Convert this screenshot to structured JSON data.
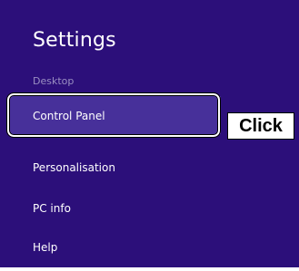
{
  "settings_pane": {
    "title": "Settings",
    "subtitle": "Desktop",
    "items": [
      {
        "label": "Control Panel"
      },
      {
        "label": "Personalisation"
      },
      {
        "label": "PC info"
      },
      {
        "label": "Help"
      }
    ]
  },
  "annotation": {
    "callout_text": "Click"
  },
  "colors": {
    "pane_background": "#2c0f7a",
    "highlight_background": "#47309a",
    "subtitle_text": "#9a8fc2"
  }
}
